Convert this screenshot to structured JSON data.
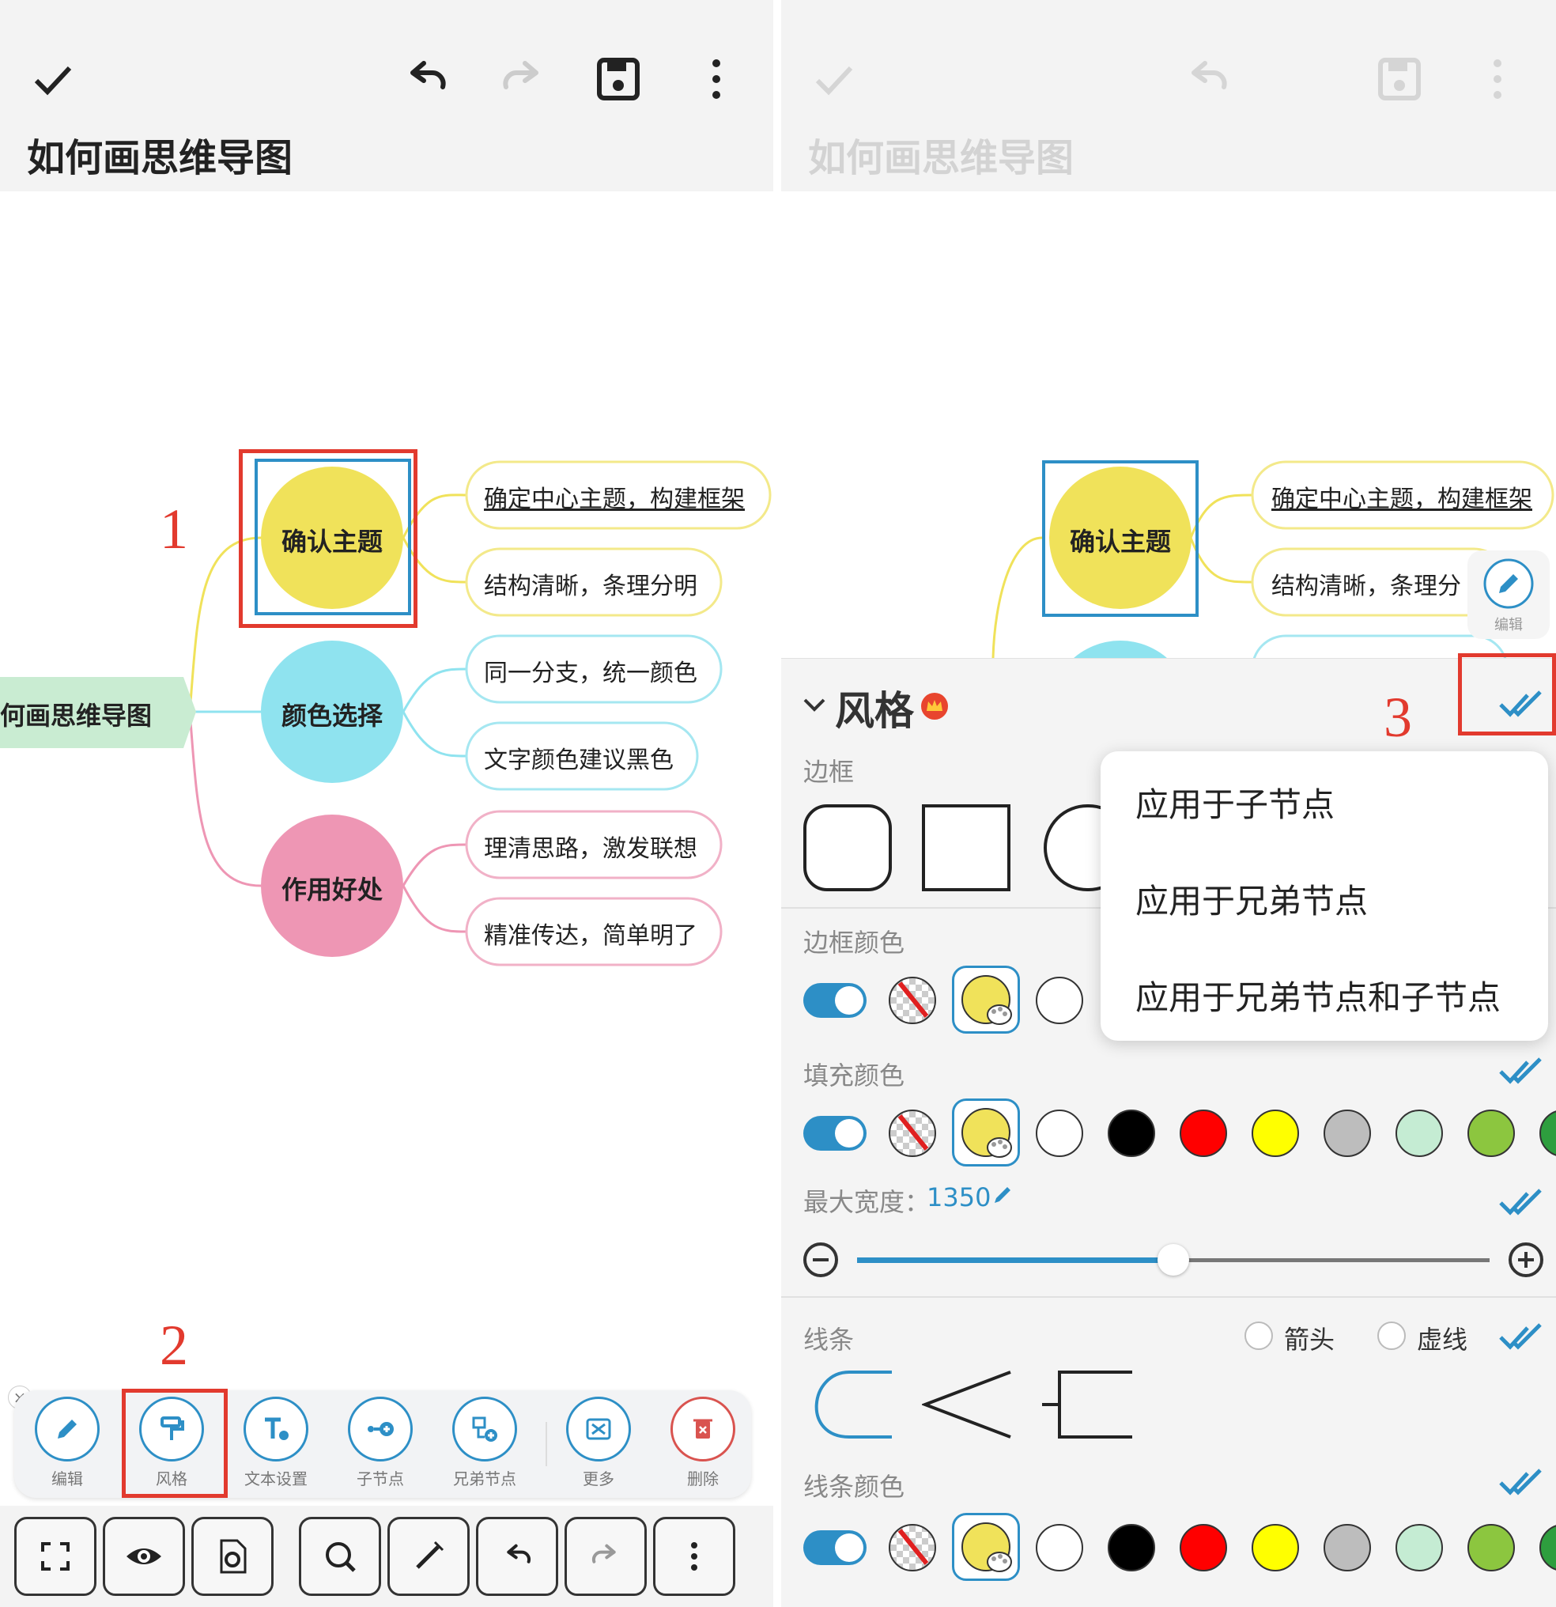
{
  "colors": {
    "accent": "#2d8fc6",
    "annotation_red": "#e23a2e",
    "yellow_node": "#f0e25a",
    "cyan_node": "#8fe3ef",
    "pink_node": "#ee96b4",
    "root_green": "#c9ecd2"
  },
  "left": {
    "toolbar_icons": [
      "check-icon",
      "undo-icon",
      "redo-icon",
      "save-icon",
      "more-vert-icon"
    ],
    "doc_title": "如何画思维导图",
    "mindmap": {
      "root": "何画思维导图",
      "branches": [
        {
          "label": "确认主题",
          "children": [
            "确定中心主题，构建框架",
            "结构清晰，条理分明"
          ]
        },
        {
          "label": "颜色选择",
          "children": [
            "同一分支，统一颜色",
            "文字颜色建议黑色"
          ]
        },
        {
          "label": "作用好处",
          "children": [
            "理清思路，激发联想",
            "精准传达，简单明了"
          ]
        }
      ]
    },
    "annotations": {
      "n1": "1",
      "n2": "2"
    },
    "node_tools": [
      {
        "label": "编辑",
        "icon": "pencil-icon"
      },
      {
        "label": "风格",
        "icon": "paint-roller-icon"
      },
      {
        "label": "文本设置",
        "icon": "text-settings-icon"
      },
      {
        "label": "子节点",
        "icon": "add-child-icon"
      },
      {
        "label": "兄弟节点",
        "icon": "add-sibling-icon"
      },
      {
        "label": "更多",
        "icon": "more-icon"
      },
      {
        "label": "删除",
        "icon": "delete-icon"
      }
    ],
    "close_label": "×",
    "app_bar_icons": [
      "fullscreen-icon",
      "eye-icon",
      "doc-settings-icon",
      "search-icon",
      "magic-icon",
      "undo-icon",
      "redo-icon",
      "more-vert-icon"
    ]
  },
  "right": {
    "doc_title": "如何画思维导图",
    "mindmap_visible": {
      "branch": "确认主题",
      "children": [
        "确定中心主题，构建框架",
        "结构清晰，条理分"
      ]
    },
    "edit_fab_label": "编辑",
    "annotation_n3": "3",
    "sheet": {
      "title": "风格",
      "border_label": "边框",
      "border_color_label": "边框颜色",
      "fill_color_label": "填充颜色",
      "max_width_label": "最大宽度：",
      "max_width_value": "1350",
      "max_width_fraction": 0.5,
      "line_label": "线条",
      "arrow_label": "箭头",
      "dashed_label": "虚线",
      "line_color_label": "线条颜色",
      "swatches": [
        "#ffffff",
        "#000000",
        "#ff0000",
        "#ffff00",
        "#bdbdbd",
        "#c5ecd3",
        "#8cc63f",
        "#2e9e3e"
      ]
    },
    "apply_menu": [
      "应用于子节点",
      "应用于兄弟节点",
      "应用于兄弟节点和子节点"
    ]
  }
}
